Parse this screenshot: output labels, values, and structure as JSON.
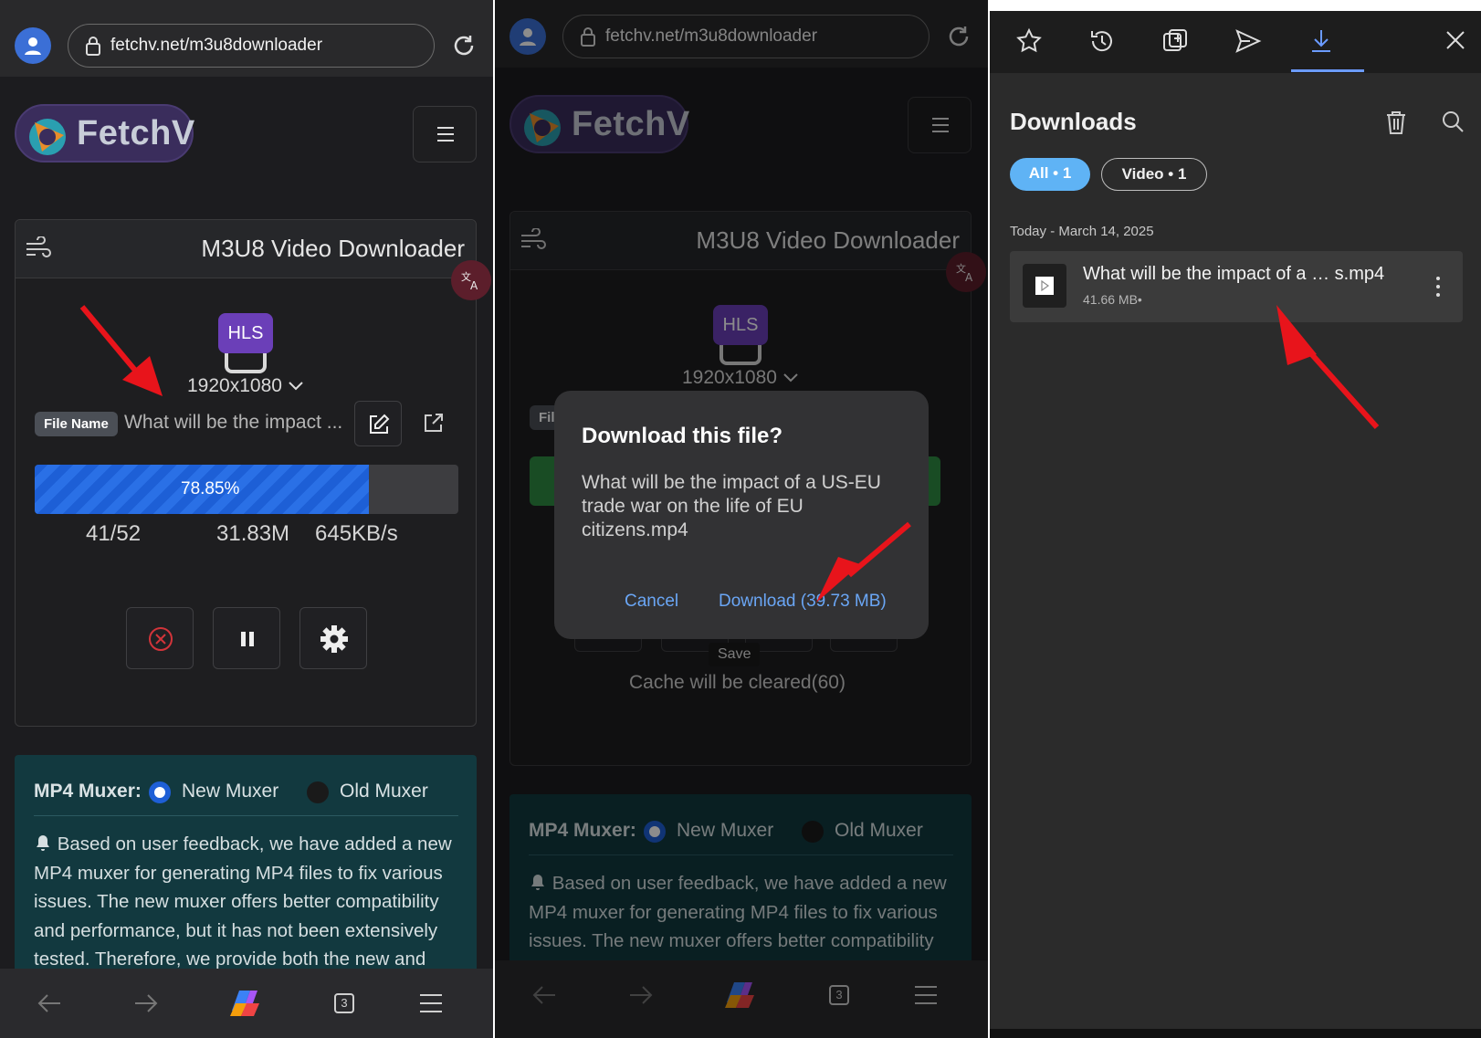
{
  "left": {
    "browser": {
      "url": "fetchv.net/m3u8downloader"
    },
    "site": {
      "logo_text": "FetchV"
    },
    "card": {
      "title": "M3U8 Video Downloader",
      "format_badge": "HLS",
      "resolution": "1920x1080",
      "file_name_label": "File Name",
      "file_name_value": "What will be the impact ...",
      "progress_percent": 78.85,
      "progress_label": "78.85%",
      "segments": "41/52",
      "size": "31.83M",
      "speed": "645KB/s"
    },
    "muxer": {
      "label": "MP4 Muxer:",
      "options": [
        "New Muxer",
        "Old Muxer"
      ],
      "selected": "New Muxer",
      "note": "Based on user feedback, we have added a new MP4 muxer for generating MP4 files to fix various issues. The new muxer offers better compatibility and performance, but it has not been extensively tested. Therefore, we provide both the new and"
    },
    "bottom": {
      "tab_count": "3"
    }
  },
  "middle": {
    "browser": {
      "url": "fetchv.net/m3u8downloader"
    },
    "site": {
      "logo_text": "FetchV"
    },
    "card": {
      "title": "M3U8 Video Downloader",
      "format_badge": "HLS",
      "resolution": "1920x1080",
      "file_name_partial": "Fil",
      "tooltip": "Save",
      "cache_text": "Cache will be cleared(60)"
    },
    "dialog": {
      "title": "Download this file?",
      "body": "What will be the impact of a US-EU trade war on the life of EU citizens.mp4",
      "cancel_label": "Cancel",
      "download_label": "Download (39.73 MB)"
    },
    "muxer": {
      "label": "MP4 Muxer:",
      "options": [
        "New Muxer",
        "Old Muxer"
      ],
      "note": "Based on user feedback, we have added a new MP4 muxer for generating MP4 files to fix various issues. The new muxer offers better compatibility"
    },
    "bottom": {
      "tab_count": "3"
    }
  },
  "right": {
    "title": "Downloads",
    "filters": [
      {
        "label": "All • 1"
      },
      {
        "label": "Video • 1"
      }
    ],
    "active_filter": "All • 1",
    "date_header": "Today - March 14, 2025",
    "items": [
      {
        "name": "What will be the impact of a … s.mp4",
        "meta": "41.66 MB•"
      }
    ]
  },
  "colors": {
    "accent_blue": "#1d5fd6",
    "link_blue": "#6aa6f5",
    "arrow_red": "#e8141b",
    "muxer_bg": "#12393f",
    "hls_purple": "#6b3fb8",
    "chip_active": "#5fb3f5"
  }
}
